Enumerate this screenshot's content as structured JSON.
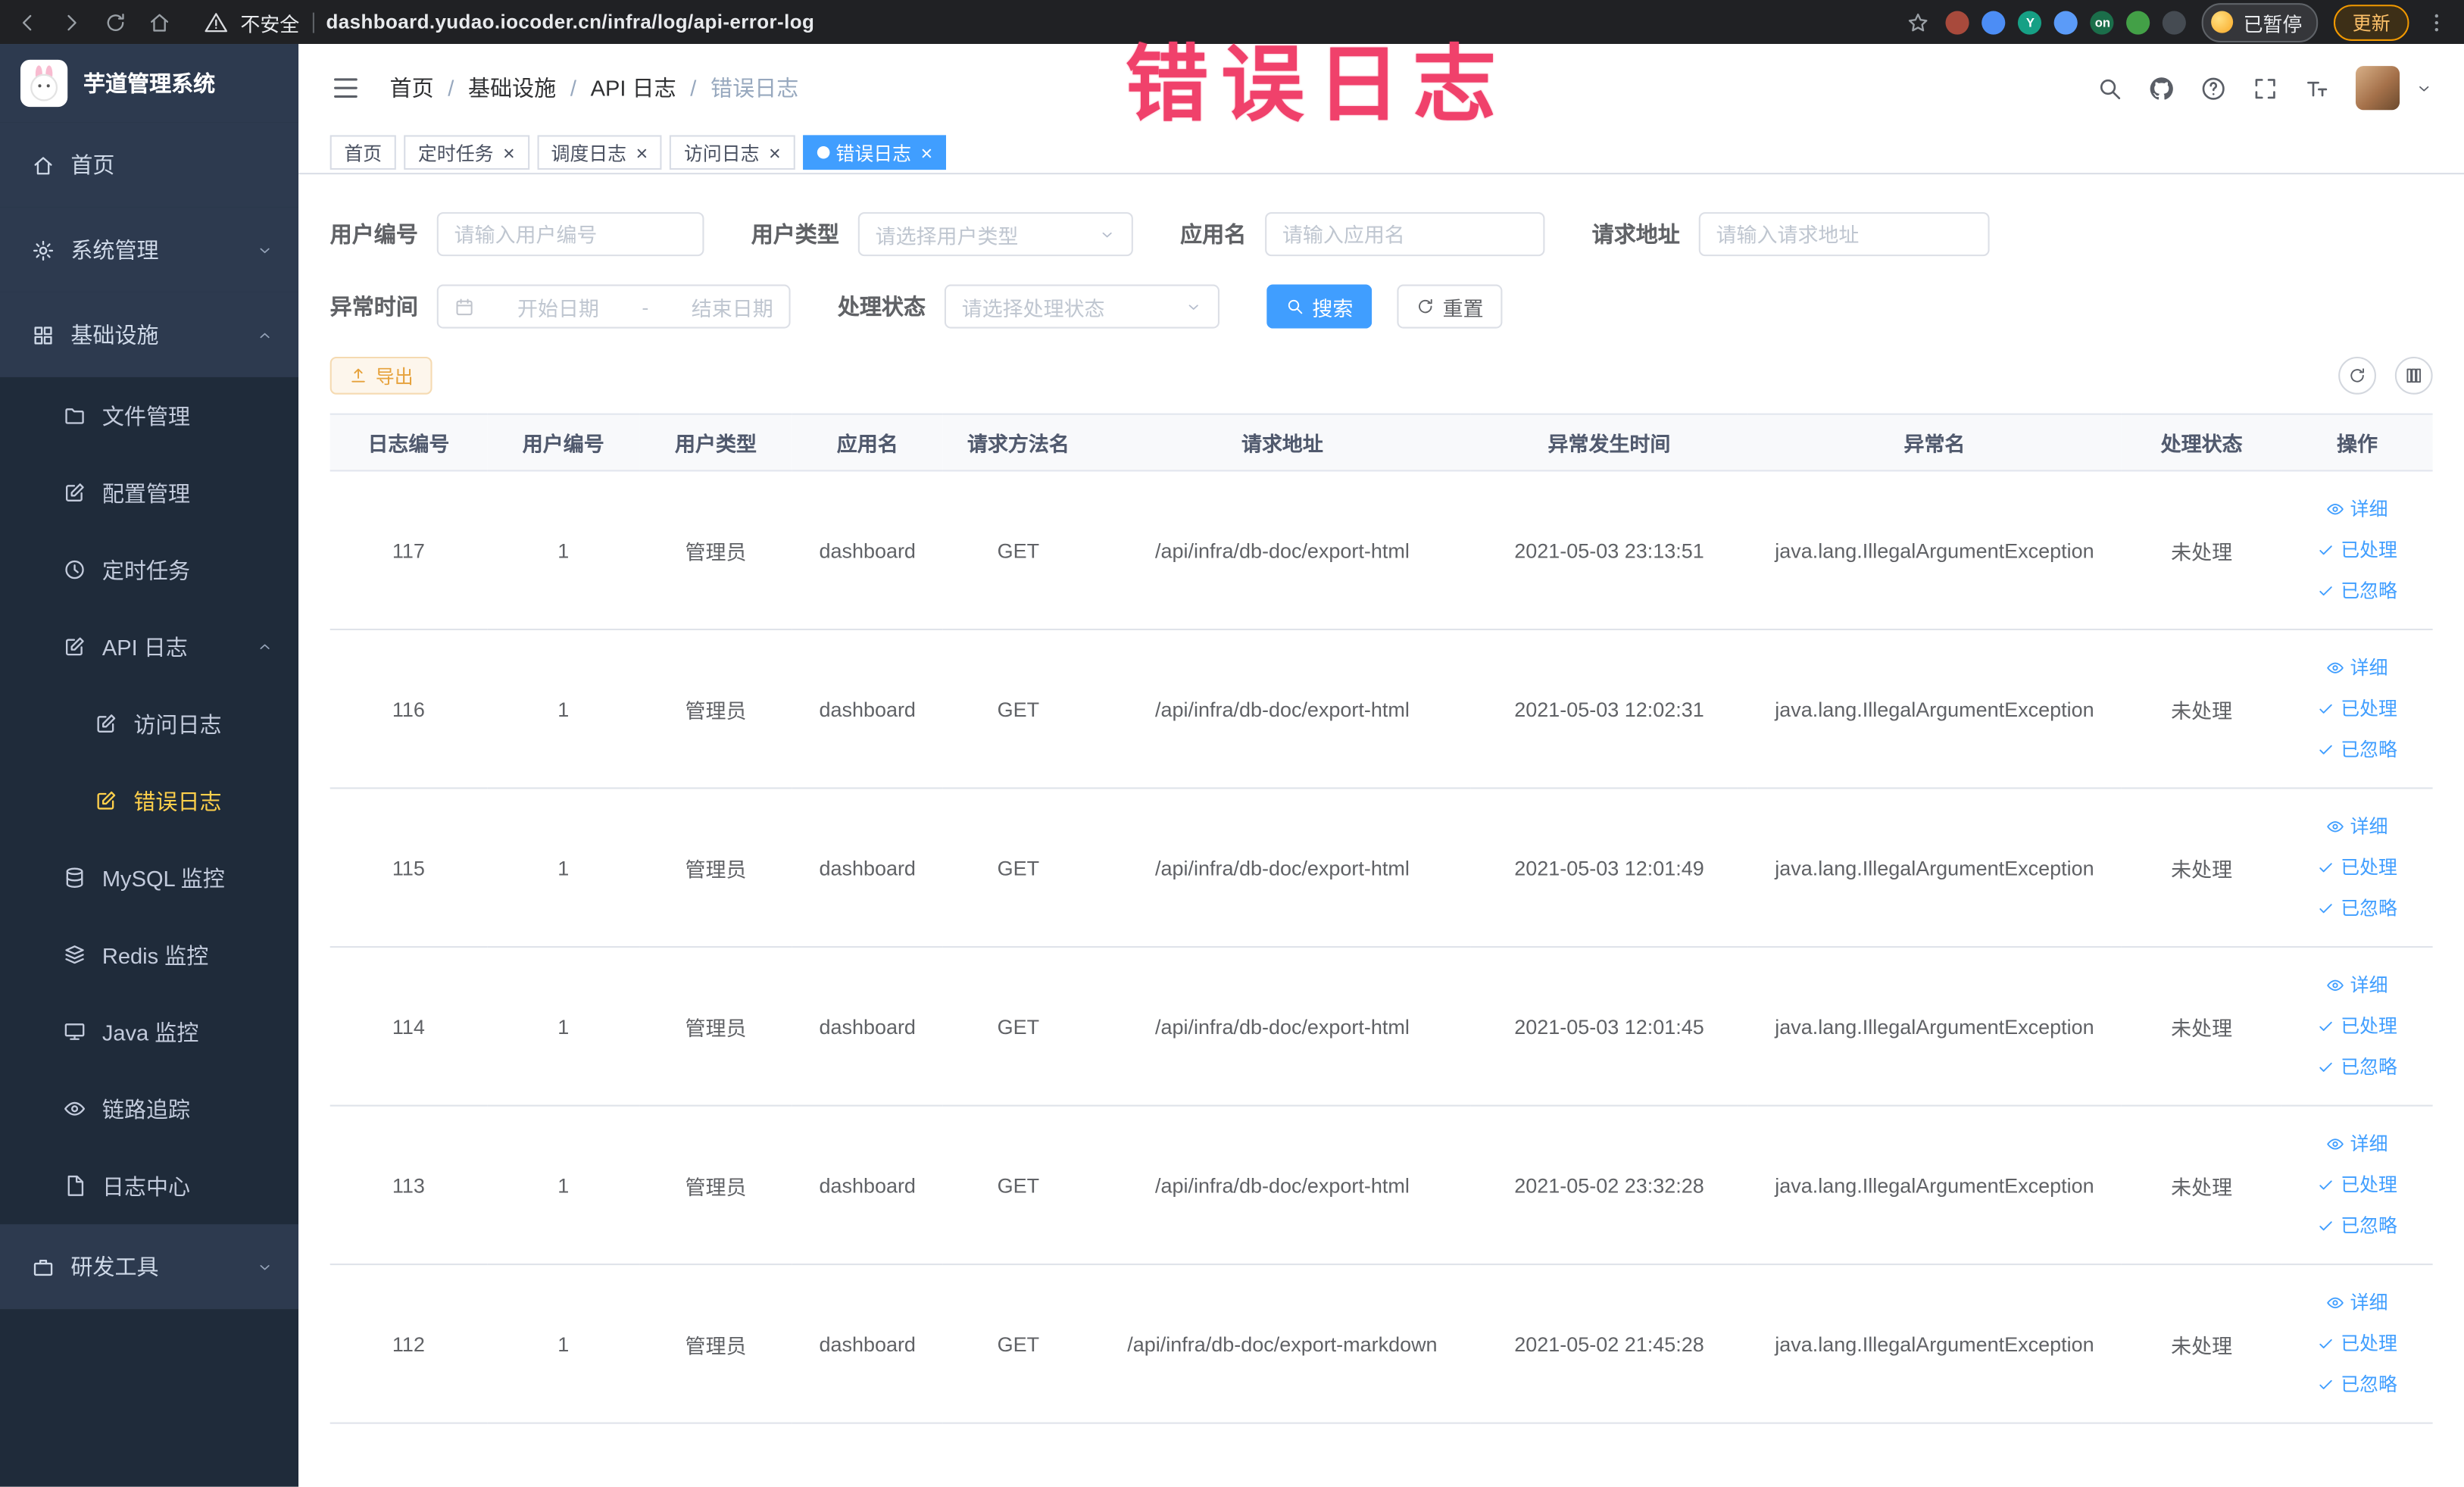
{
  "colors": {
    "primary": "#409eff",
    "link": "#409eff",
    "warning": "#e6a23c",
    "warning-bg": "#fdf6ec",
    "warning-border": "#f5dab1",
    "sidebar-bg": "#2d3a4f",
    "submenu-bg": "#1f2b3a",
    "sidebar-active": "#ffd04b",
    "watermark": "#f0416b",
    "chrome-bg": "#202124"
  },
  "browser": {
    "security_label": "不安全",
    "url": "dashboard.yudao.iocoder.cn/infra/log/api-error-log",
    "paused_label": "已暂停",
    "update_label": "更新",
    "extensions": [
      {
        "name": "extension-icon-red",
        "color": "#a84a3c"
      },
      {
        "name": "extension-icon-blue-drop",
        "color": "#4c8df5"
      },
      {
        "name": "extension-icon-green-y",
        "color": "#16a085",
        "text": "Y"
      },
      {
        "name": "extension-icon-blue-grid",
        "color": "#5b9bf8"
      },
      {
        "name": "extension-icon-on-badge",
        "color": "#1b6e4a",
        "text": "on"
      },
      {
        "name": "extension-icon-green-leaf",
        "color": "#43a047"
      },
      {
        "name": "extension-icon-paw",
        "color": "#454b52"
      }
    ]
  },
  "watermark": "错误日志",
  "sidebar": {
    "logo_title": "芋道管理系统",
    "menu": [
      {
        "key": "home",
        "label": "首页",
        "icon": "home",
        "level": 1
      },
      {
        "key": "system",
        "label": "系统管理",
        "icon": "gear",
        "level": 1,
        "arrow": "down"
      },
      {
        "key": "infra",
        "label": "基础设施",
        "icon": "grid",
        "level": 1,
        "arrow": "up"
      },
      {
        "key": "file",
        "label": "文件管理",
        "icon": "folder",
        "level": 2
      },
      {
        "key": "config",
        "label": "配置管理",
        "icon": "edit",
        "level": 2
      },
      {
        "key": "job",
        "label": "定时任务",
        "icon": "clock",
        "level": 2
      },
      {
        "key": "api-log",
        "label": "API 日志",
        "icon": "edit",
        "level": 2,
        "arrow": "up"
      },
      {
        "key": "access-log",
        "label": "访问日志",
        "icon": "edit",
        "level": 3
      },
      {
        "key": "error-log",
        "label": "错误日志",
        "icon": "edit",
        "level": 3,
        "active": true
      },
      {
        "key": "mysql",
        "label": "MySQL 监控",
        "icon": "db",
        "level": 2
      },
      {
        "key": "redis",
        "label": "Redis 监控",
        "icon": "redis",
        "level": 2
      },
      {
        "key": "java",
        "label": "Java 监控",
        "icon": "monitor",
        "level": 2
      },
      {
        "key": "trace",
        "label": "链路追踪",
        "icon": "eye",
        "level": 2
      },
      {
        "key": "log-center",
        "label": "日志中心",
        "icon": "doc",
        "level": 2
      },
      {
        "key": "devtools",
        "label": "研发工具",
        "icon": "tools",
        "level": 1,
        "arrow": "down"
      }
    ]
  },
  "header": {
    "breadcrumb": [
      "首页",
      "基础设施",
      "API 日志",
      "错误日志"
    ]
  },
  "tabs": [
    {
      "label": "首页",
      "closable": false,
      "active": false
    },
    {
      "label": "定时任务",
      "closable": true,
      "active": false
    },
    {
      "label": "调度日志",
      "closable": true,
      "active": false
    },
    {
      "label": "访问日志",
      "closable": true,
      "active": false
    },
    {
      "label": "错误日志",
      "closable": true,
      "active": true
    }
  ],
  "filters": {
    "user_id": {
      "label": "用户编号",
      "placeholder": "请输入用户编号"
    },
    "user_type": {
      "label": "用户类型",
      "placeholder": "请选择用户类型"
    },
    "app_name": {
      "label": "应用名",
      "placeholder": "请输入应用名"
    },
    "request_url": {
      "label": "请求地址",
      "placeholder": "请输入请求地址"
    },
    "exception_time": {
      "label": "异常时间",
      "start_placeholder": "开始日期",
      "separator": "-",
      "end_placeholder": "结束日期"
    },
    "process_status": {
      "label": "处理状态",
      "placeholder": "请选择处理状态"
    },
    "search_label": "搜索",
    "reset_label": "重置"
  },
  "toolbar": {
    "export_label": "导出"
  },
  "table": {
    "columns": [
      "日志编号",
      "用户编号",
      "用户类型",
      "应用名",
      "请求方法名",
      "请求地址",
      "异常发生时间",
      "异常名",
      "处理状态",
      "操作"
    ],
    "actions": [
      {
        "key": "detail",
        "label": "详细",
        "icon": "eye"
      },
      {
        "key": "processed",
        "label": "已处理",
        "icon": "check"
      },
      {
        "key": "ignored",
        "label": "已忽略",
        "icon": "check"
      }
    ],
    "rows": [
      {
        "id": "117",
        "user_id": "1",
        "user_type": "管理员",
        "app": "dashboard",
        "method": "GET",
        "url": "/api/infra/db-doc/export-html",
        "time": "2021-05-03 23:13:51",
        "exception": "java.lang.IllegalArgumentException",
        "status": "未处理"
      },
      {
        "id": "116",
        "user_id": "1",
        "user_type": "管理员",
        "app": "dashboard",
        "method": "GET",
        "url": "/api/infra/db-doc/export-html",
        "time": "2021-05-03 12:02:31",
        "exception": "java.lang.IllegalArgumentException",
        "status": "未处理"
      },
      {
        "id": "115",
        "user_id": "1",
        "user_type": "管理员",
        "app": "dashboard",
        "method": "GET",
        "url": "/api/infra/db-doc/export-html",
        "time": "2021-05-03 12:01:49",
        "exception": "java.lang.IllegalArgumentException",
        "status": "未处理"
      },
      {
        "id": "114",
        "user_id": "1",
        "user_type": "管理员",
        "app": "dashboard",
        "method": "GET",
        "url": "/api/infra/db-doc/export-html",
        "time": "2021-05-03 12:01:45",
        "exception": "java.lang.IllegalArgumentException",
        "status": "未处理"
      },
      {
        "id": "113",
        "user_id": "1",
        "user_type": "管理员",
        "app": "dashboard",
        "method": "GET",
        "url": "/api/infra/db-doc/export-html",
        "time": "2021-05-02 23:32:28",
        "exception": "java.lang.IllegalArgumentException",
        "status": "未处理"
      },
      {
        "id": "112",
        "user_id": "1",
        "user_type": "管理员",
        "app": "dashboard",
        "method": "GET",
        "url": "/api/infra/db-doc/export-markdown",
        "time": "2021-05-02 21:45:28",
        "exception": "java.lang.IllegalArgumentException",
        "status": "未处理"
      }
    ]
  }
}
